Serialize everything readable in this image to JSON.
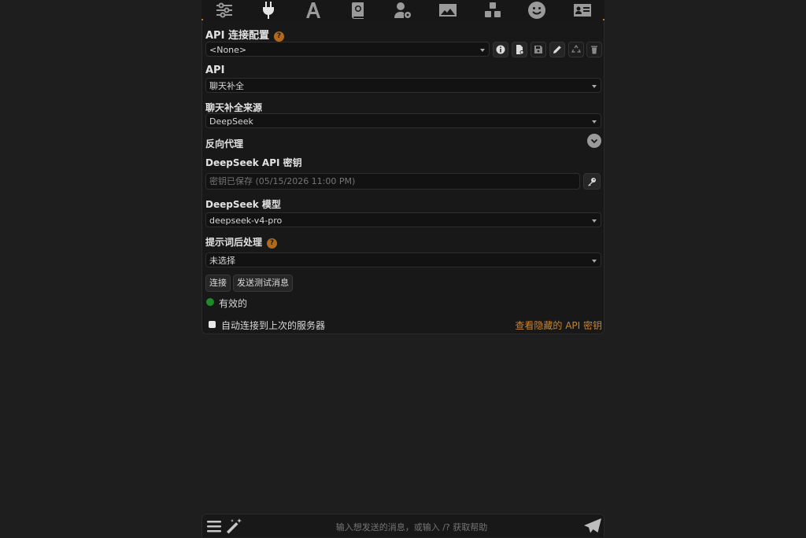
{
  "nav": {
    "icons": [
      "sliders-icon",
      "plug-icon",
      "font-icon",
      "book-icon",
      "user-gear-icon",
      "image-icon",
      "cubes-icon",
      "smile-icon",
      "id-card-icon"
    ],
    "active": "plug-icon"
  },
  "api_profile": {
    "label": "API 连接配置",
    "help": "?",
    "selected": "<None>"
  },
  "api": {
    "label": "API",
    "selected": "聊天补全"
  },
  "source": {
    "label": "聊天补全来源",
    "selected": "DeepSeek"
  },
  "proxy": {
    "label": "反向代理"
  },
  "key": {
    "label": "DeepSeek API 密钥",
    "placeholder": "密钥已保存 (05/15/2026 11:00 PM)"
  },
  "model": {
    "label": "DeepSeek 模型",
    "selected": "deepseek-v4-pro"
  },
  "postprocess": {
    "label": "提示词后处理",
    "help": "?",
    "selected": "未选择"
  },
  "buttons": {
    "connect": "连接",
    "send_test": "发送测试消息"
  },
  "status": {
    "text": "有效的",
    "color": "#1f8a2a"
  },
  "auto_connect": {
    "label": "自动连接到上次的服务器",
    "checked": false
  },
  "view_hidden_keys": "查看隐藏的 API 密钥",
  "chat_input": {
    "placeholder": "输入想发送的消息，或输入 /? 获取帮助"
  },
  "colors": {
    "accent": "#c9832c",
    "background": "#1e1e1e",
    "panel": "#181818"
  }
}
